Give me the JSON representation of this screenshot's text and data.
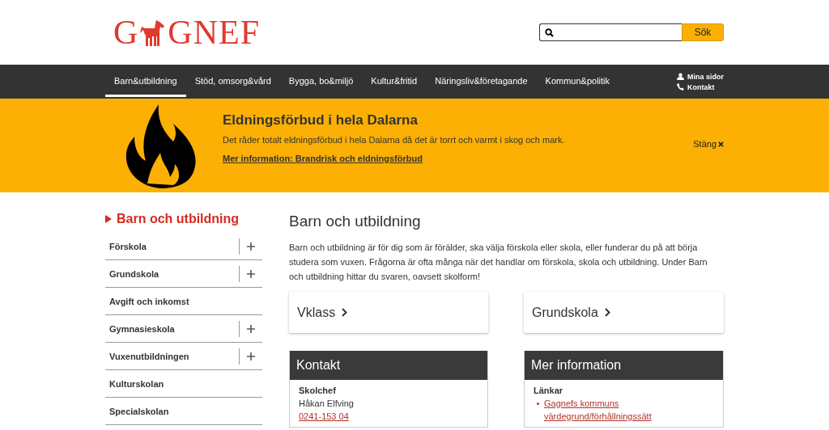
{
  "logo": {
    "text_before": "G",
    "text_after": "GNEF"
  },
  "search": {
    "button": "Sök"
  },
  "nav": {
    "items": [
      {
        "label": "Barn&utbildning",
        "selected": true
      },
      {
        "label": "Stöd, omsorg&vård",
        "selected": false
      },
      {
        "label": "Bygga, bo&miljö",
        "selected": false
      },
      {
        "label": "Kultur&fritid",
        "selected": false
      },
      {
        "label": "Näringsliv&företagande",
        "selected": false
      },
      {
        "label": "Kommun&politik",
        "selected": false
      }
    ],
    "links": [
      {
        "kind": "user",
        "label": "Mina sidor"
      },
      {
        "kind": "phone",
        "label": "Kontakt"
      }
    ]
  },
  "alert": {
    "title": "Eldningsförbud i hela Dalarna",
    "text": "Det råder totalt eldningsförbud i hela Dalarna då det är torrt och varmt i skog och mark.",
    "link": "Mer information: Brandrisk och eldningsförbud",
    "close": "Stäng"
  },
  "sidebar": {
    "title": "Barn och utbildning",
    "items": [
      {
        "label": "Förskola",
        "expandable": true
      },
      {
        "label": "Grundskola",
        "expandable": true
      },
      {
        "label": "Avgift och inkomst",
        "expandable": false
      },
      {
        "label": "Gymnasieskola",
        "expandable": true
      },
      {
        "label": "Vuxenutbildningen",
        "expandable": true
      },
      {
        "label": "Kulturskolan",
        "expandable": false
      },
      {
        "label": "Specialskolan",
        "expandable": false
      }
    ]
  },
  "main": {
    "title": "Barn och utbildning",
    "intro": "Barn och utbildning är för dig som är förälder, ska välja förskola eller skola, eller funderar du på att börja studera som vuxen. Frågorna är ofta många när det handlar om förskola, skola och utbildning. Under Barn och utbildning hittar du svaren, oavsett skolform!",
    "cards": [
      "Vklass",
      "Grundskola"
    ],
    "contact": {
      "title": "Kontakt",
      "role": "Skolchef",
      "name": "Håkan Elfving",
      "phone": "0241-153 04"
    },
    "more": {
      "title": "Mer information",
      "subtitle": "Länkar",
      "links": [
        "Gagnefs kommuns värdegrund/förhållningssätt"
      ]
    }
  }
}
